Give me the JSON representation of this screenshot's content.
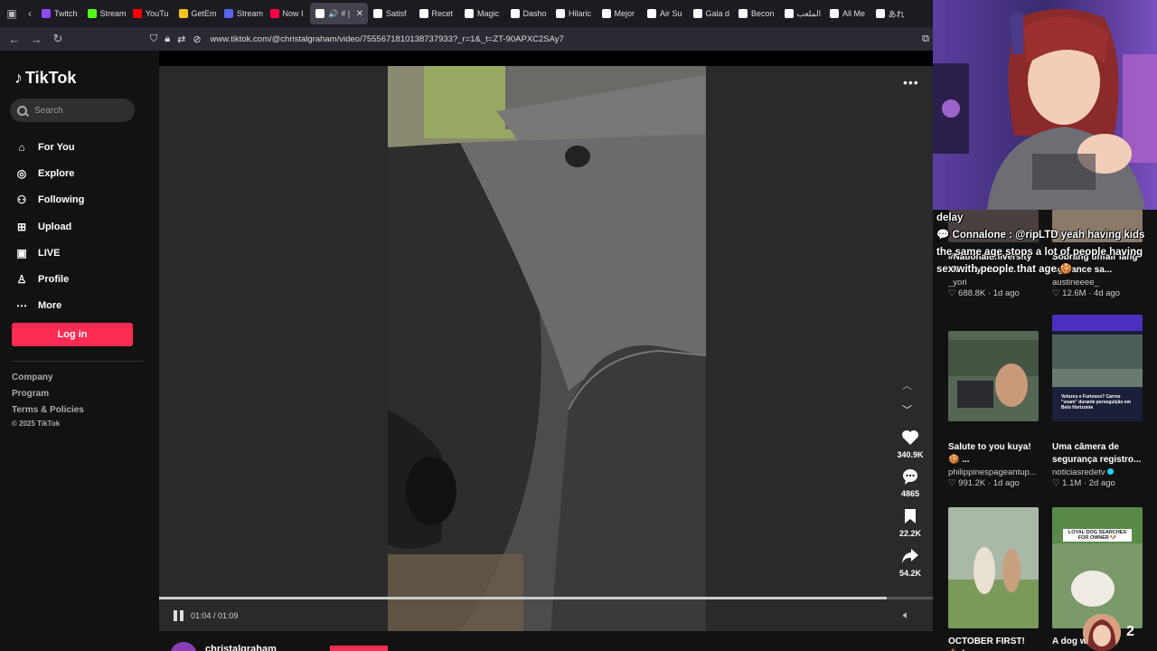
{
  "browser": {
    "tabs": [
      {
        "label": "Twitch",
        "color": "#9146ff"
      },
      {
        "label": "Stream",
        "color": "#53fc18"
      },
      {
        "label": "YouTu",
        "color": "#ff0000"
      },
      {
        "label": "GetEm",
        "color": "#f5c518"
      },
      {
        "label": "Stream",
        "color": "#5865f2"
      },
      {
        "label": "Now I",
        "color": "#ff0044"
      },
      {
        "label": "Satisf",
        "color": "#ffffff"
      },
      {
        "label": "Recet",
        "color": "#ffffff"
      },
      {
        "label": "Magic",
        "color": "#ffffff"
      },
      {
        "label": "Dasho",
        "color": "#ffffff"
      },
      {
        "label": "Hilaric",
        "color": "#ffffff"
      },
      {
        "label": "Mejor",
        "color": "#ffffff"
      },
      {
        "label": "Air Su",
        "color": "#ffffff"
      },
      {
        "label": "Gala d",
        "color": "#ffffff"
      },
      {
        "label": "Becon",
        "color": "#ffffff"
      },
      {
        "label": "الملعب",
        "color": "#ffffff"
      },
      {
        "label": "All Me",
        "color": "#ffffff"
      },
      {
        "label": "あれ",
        "color": "#ffffff"
      }
    ],
    "active_tab": {
      "label": "# |"
    },
    "url": "www.tiktok.com/@christalgraham/video/7555671810138737933?_r=1&_t=ZT-90APXC2SAy7"
  },
  "tiktok": {
    "logo_text": "TikTok",
    "search_placeholder": "Search",
    "nav": [
      {
        "label": "For You",
        "icon": "home-icon"
      },
      {
        "label": "Explore",
        "icon": "compass-icon"
      },
      {
        "label": "Following",
        "icon": "following-icon"
      },
      {
        "label": "Upload",
        "icon": "upload-icon"
      },
      {
        "label": "LIVE",
        "icon": "live-icon"
      },
      {
        "label": "Profile",
        "icon": "profile-icon"
      },
      {
        "label": "More",
        "icon": "more-icon"
      }
    ],
    "login_label": "Log in",
    "footer_links": [
      "Company",
      "Program",
      "Terms & Policies"
    ],
    "copyright": "© 2025 TikTok",
    "accent": "#fe2c55"
  },
  "video": {
    "likes": "340.9K",
    "comments": "4865",
    "saves": "22.2K",
    "shares": "54.2K",
    "current_time": "01:04",
    "duration": "01:09",
    "time_display": "01:04 / 01:09",
    "progress": 0.94,
    "author": "christalgraham"
  },
  "stream": {
    "chat_overlay": "delay\n💬 Connalone : @ripLTD yeah having kids the same age stops a lot of people having sex with people that age 🍪",
    "cards": [
      {
        "title": "#Nationaluniversity #Mahayohado...",
        "user": "_yori",
        "views": "688.8K",
        "age": "1d ago"
      },
      {
        "title": "Sobrang unfair lang ng fiance sa...",
        "user": "austineeee_",
        "views": "12.6M",
        "age": "4d ago"
      },
      {
        "title": "Salute to you kuya! 🍪 ...",
        "user": "philippinespageantup...",
        "views": "991.2K",
        "age": "1d ago"
      },
      {
        "title": "Uma câmera de segurança registro...",
        "user": "noticiasredetv",
        "views": "1.1M",
        "age": "2d ago",
        "verified": true
      },
      {
        "title": "OCTOBER FIRST! 🐐 |",
        "user": "",
        "views": "",
        "age": ""
      },
      {
        "title": "A dog w",
        "user": "",
        "views": "",
        "age": ""
      }
    ],
    "thumb4_caption": "Velozes e Furiosos? Carros \"voam\" durante perseguição em Belo Horizonte",
    "thumb6_caption": "LOYAL DOG SEARCHES FOR OWNER 🐶",
    "pip_count": "2"
  }
}
